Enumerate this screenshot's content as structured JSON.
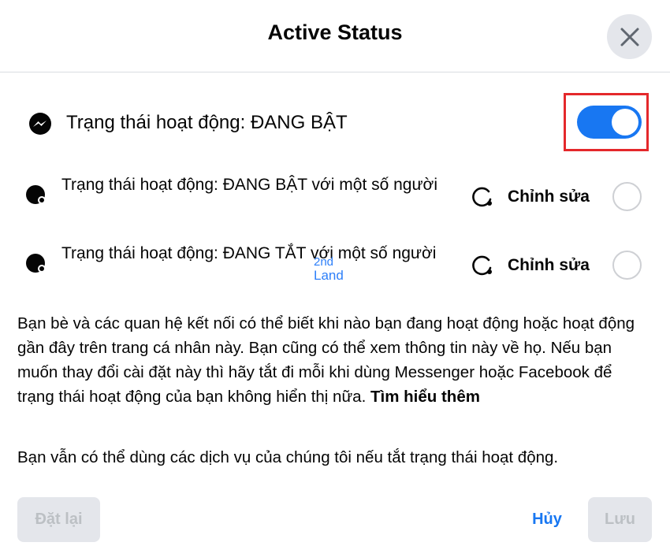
{
  "dialog": {
    "title": "Active Status",
    "close_icon": "close-icon"
  },
  "main_toggle": {
    "label": "Trạng thái hoạt động: ĐANG BẬT",
    "icon": "messenger-icon",
    "state": "on",
    "accent_color": "#1877f2",
    "highlight_color": "#e4282b"
  },
  "options": [
    {
      "label": "Trạng thái hoạt động: ĐANG BẬT với một số người",
      "edit_label": "Chỉnh sửa",
      "icon": "active-dot-icon"
    },
    {
      "label": "Trạng thái hoạt động: ĐANG TẮT với một số người",
      "edit_label": "Chỉnh sửa",
      "icon": "active-dot-icon"
    }
  ],
  "watermark": {
    "line1": "2nd",
    "line2": "Land"
  },
  "description": {
    "text": "Bạn bè và các quan hệ kết nối có thể biết khi nào bạn đang hoạt động hoặc hoạt động gần đây trên trang cá nhân này. Bạn cũng có thể xem thông tin này về họ. Nếu bạn muốn thay đổi cài đặt này thì hãy tắt đi mỗi khi dùng Messenger hoặc Facebook để trạng thái hoạt động của bạn không hiển thị nữa.",
    "learn_more": "Tìm hiểu thêm",
    "note": "Bạn vẫn có thể dùng các dịch vụ của chúng tôi nếu tắt trạng thái hoạt động."
  },
  "footer": {
    "reset_label": "Đặt lại",
    "cancel_label": "Hủy",
    "save_label": "Lưu"
  }
}
